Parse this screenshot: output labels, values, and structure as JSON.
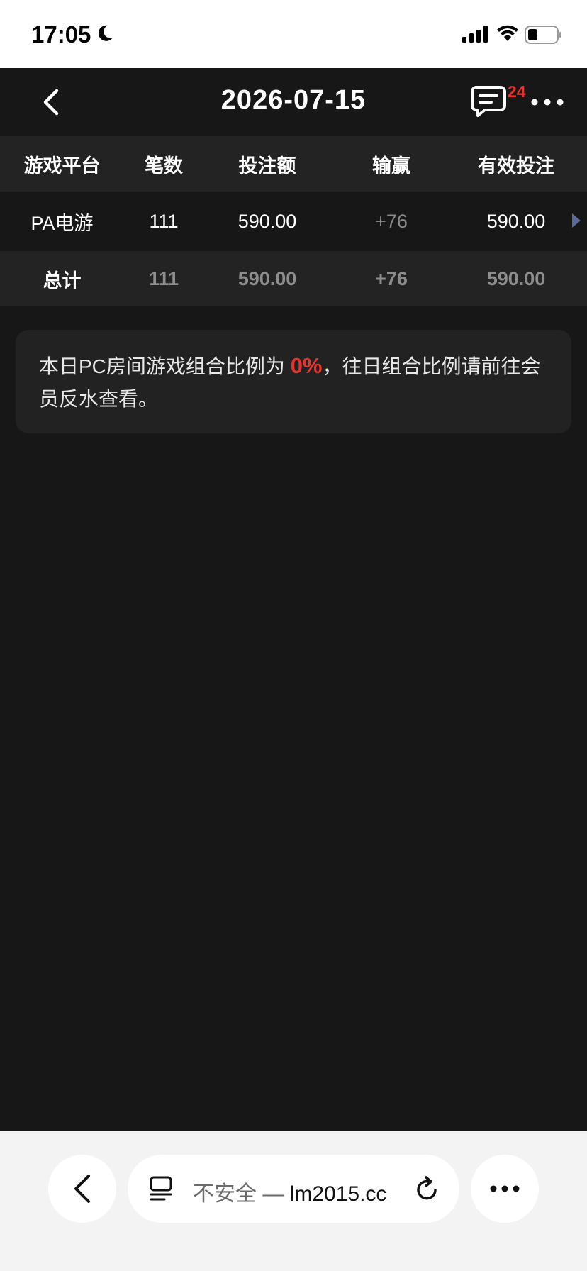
{
  "status_bar": {
    "time": "17:05"
  },
  "nav": {
    "title": "2026-07-15",
    "chat_badge": "24"
  },
  "table": {
    "headers": [
      "游戏平台",
      "笔数",
      "投注额",
      "输赢",
      "有效投注"
    ],
    "rows": [
      {
        "platform": "PA电游",
        "count": "111",
        "bet": "590.00",
        "win_loss": "+76",
        "valid_bet": "590.00"
      }
    ],
    "total": {
      "label": "总计",
      "count": "111",
      "bet": "590.00",
      "win_loss": "+76",
      "valid_bet": "590.00"
    }
  },
  "notice": {
    "prefix": "本日PC房间游戏组合比例为 ",
    "percent": "0%",
    "suffix": "，往日组合比例请前往会员反水查看。"
  },
  "browser": {
    "security_label": "不安全",
    "separator": " — ",
    "domain": "lm2015.cc"
  },
  "colors": {
    "accent_red": "#e8322c",
    "background": "#171717",
    "header_bg": "#232323"
  }
}
